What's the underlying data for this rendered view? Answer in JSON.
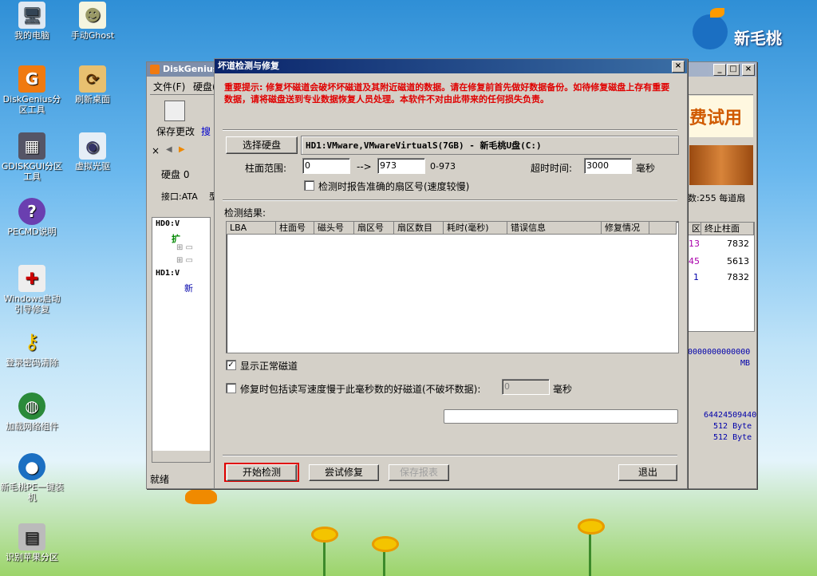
{
  "desktop": {
    "icons": [
      {
        "label": "我的电脑",
        "icon": "computer-icon"
      },
      {
        "label": "手动Ghost",
        "icon": "ghost-icon"
      },
      {
        "label": "DiskGenius分区工具",
        "icon": "diskgenius-icon"
      },
      {
        "label": "刷新桌面",
        "icon": "refresh-icon"
      },
      {
        "label": "GDISKGUI分区工具",
        "icon": "gdisk-icon"
      },
      {
        "label": "虚拟光驱",
        "icon": "cdrom-icon"
      },
      {
        "label": "PECMD说明",
        "icon": "help-icon"
      },
      {
        "label": "Windows启动引导修复",
        "icon": "repair-icon"
      },
      {
        "label": "登录密码清除",
        "icon": "key-icon"
      },
      {
        "label": "加载网络组件",
        "icon": "network-icon"
      },
      {
        "label": "新毛桃PE一键装机",
        "icon": "install-icon"
      },
      {
        "label": "识别苹果分区",
        "icon": "apple-disk-icon"
      }
    ],
    "logo_text": "新毛桃"
  },
  "back_window": {
    "title": "DiskGenius",
    "menu": [
      "文件(F)",
      "硬盘("
    ],
    "toolbar": [
      "保存更改",
      "搜"
    ],
    "disk_label": "硬盘 0",
    "iface_label": "接口:ATA",
    "iface_extra": "型",
    "tree": [
      "HD0:V",
      "扩",
      "HD1:V",
      "新"
    ],
    "status": "就绪",
    "banner_text": "费试用",
    "right_info": "数:255  每道扇",
    "table_headers": [
      "区",
      "终止柱面"
    ],
    "table_rows": [
      [
        "13",
        "7832"
      ],
      [
        "45",
        "5613"
      ],
      [
        "1",
        "7832"
      ]
    ],
    "hex_tail": "0000000000000",
    "mb_label": "MB",
    "bytes": [
      "64424509440",
      "512 Byte",
      "512 Byte"
    ]
  },
  "dialog": {
    "title": "坏道检测与修复",
    "warning": "重要提示: 修复坏磁道会破坏坏磁道及其附近磁道的数据。请在修复前首先做好数据备份。如待修复磁盘上存有重要数据，请将磁盘送到专业数据恢复人员处理。本软件不对由此带来的任何损失负责。",
    "select_disk_label": "选择硬盘",
    "disk_name": "HD1:VMware,VMwareVirtualS(7GB) - 新毛桃U盘(C:)",
    "cyl_range_label": "柱面范围:",
    "cyl_start": "0",
    "arrow": "-->",
    "cyl_end": "973",
    "cyl_hint": "0-973",
    "timeout_label": "超时时间:",
    "timeout_value": "3000",
    "ms_unit": "毫秒",
    "report_sector_label": "检测时报告准确的扇区号(速度较慢)",
    "result_label": "检测结果:",
    "columns": [
      "LBA",
      "柱面号",
      "磁头号",
      "扇区号",
      "扇区数目",
      "耗时(毫秒)",
      "错误信息",
      "修复情况"
    ],
    "show_normal_label": "显示正常磁道",
    "show_normal_checked": true,
    "include_slow_label": "修复时包括读写速度慢于此毫秒数的好磁道(不破坏数据):",
    "include_slow_checked": false,
    "slow_ms_value": "0",
    "slow_ms_unit": "毫秒",
    "progress": 0,
    "buttons": {
      "start": "开始检测",
      "try_repair": "尝试修复",
      "save_report": "保存报表",
      "exit": "退出"
    }
  }
}
